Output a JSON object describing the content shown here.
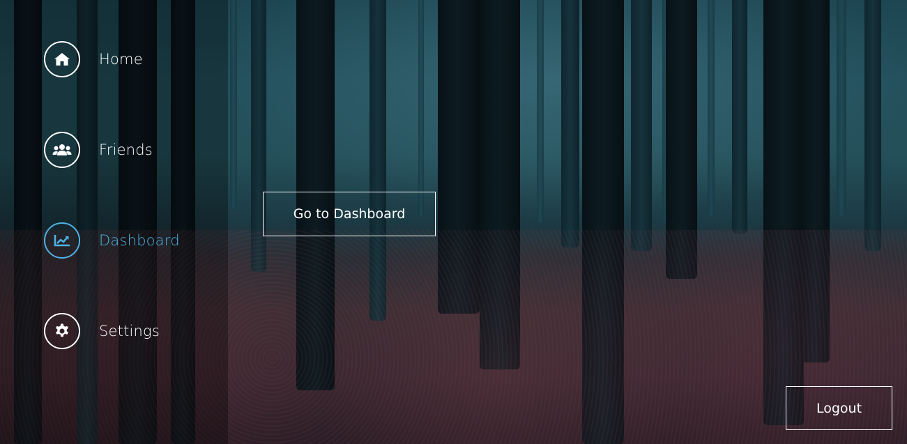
{
  "sidebar": {
    "items": [
      {
        "label": "Home",
        "icon": "home-icon",
        "active": false
      },
      {
        "label": "Friends",
        "icon": "users-icon",
        "active": false
      },
      {
        "label": "Dashboard",
        "icon": "chart-line-icon",
        "active": true
      },
      {
        "label": "Settings",
        "icon": "gear-icon",
        "active": false
      }
    ]
  },
  "main": {
    "dashboard_button_label": "Go to Dashboard"
  },
  "footer": {
    "logout_label": "Logout"
  },
  "colors": {
    "accent": "#4fb3e6",
    "text": "#ffffff"
  }
}
